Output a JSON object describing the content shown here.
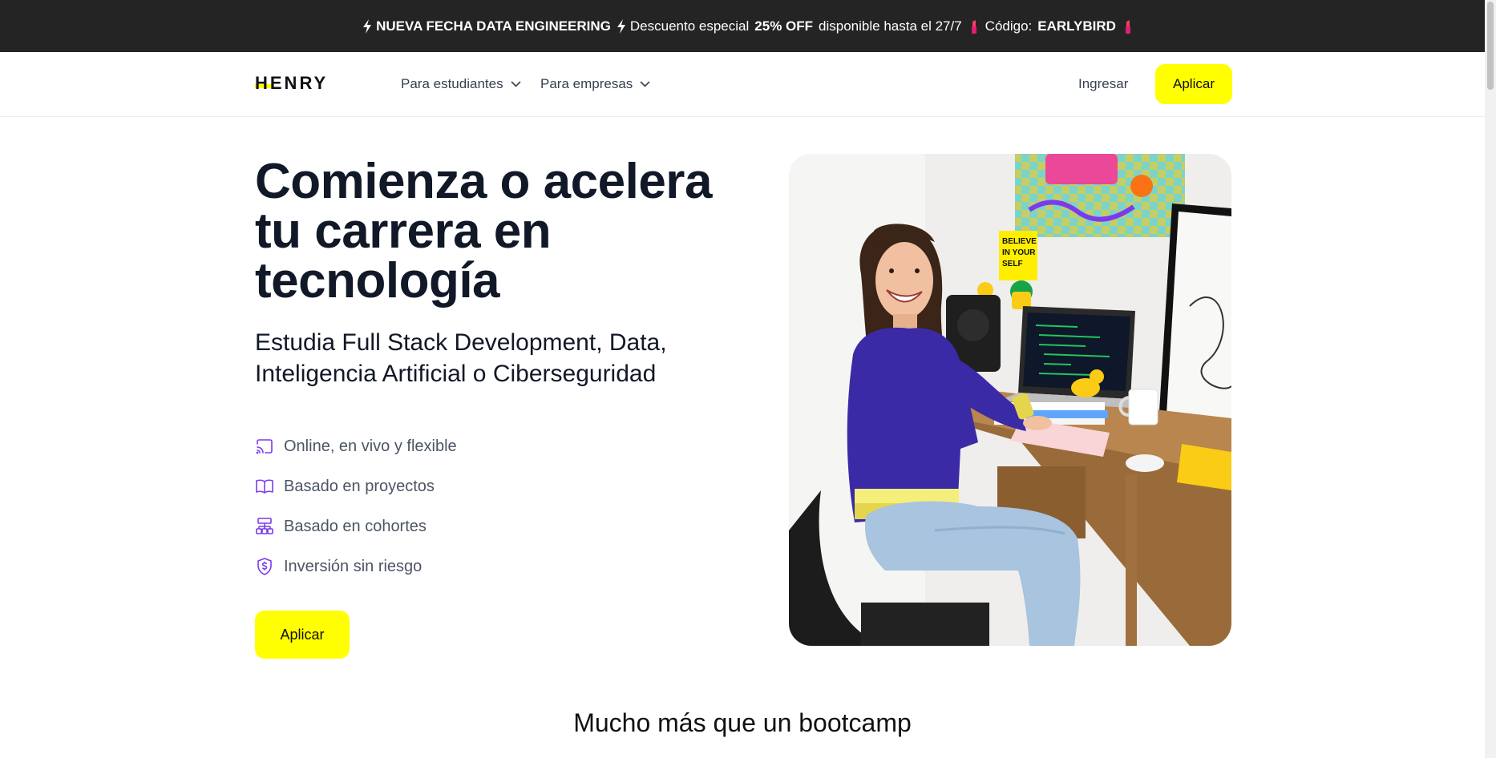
{
  "promo": {
    "title": "NUEVA FECHA DATA ENGINEERING",
    "discount_text": "Descuento especial",
    "discount_value": "25% OFF",
    "availability": "disponible hasta el 27/7",
    "code_label": "Código:",
    "code": "EARLYBIRD",
    "icons": [
      "lightning-icon",
      "lipstick-icon"
    ]
  },
  "nav": {
    "logo_text": "HENRY",
    "links": [
      {
        "label": "Para estudiantes",
        "icon": "chevron-down-icon"
      },
      {
        "label": "Para empresas",
        "icon": "chevron-down-icon"
      }
    ],
    "login_label": "Ingresar",
    "apply_label": "Aplicar"
  },
  "hero": {
    "title_lines": [
      "Comienza o acelera",
      "tu carrera en",
      "tecnología"
    ],
    "subtitle_lines": [
      "Estudia Full Stack Development, Data,",
      "Inteligencia Artificial o Ciberseguridad"
    ],
    "features": [
      {
        "label": "Online, en vivo y flexible",
        "icon": "cast-icon"
      },
      {
        "label": "Basado en proyectos",
        "icon": "book-icon"
      },
      {
        "label": "Basado en cohortes",
        "icon": "network-icon"
      },
      {
        "label": "Inversión sin riesgo",
        "icon": "shield-dollar-icon"
      }
    ],
    "apply_label": "Aplicar",
    "image_poster_text": [
      "BELIEVE",
      "IN YOUR",
      "SELF"
    ]
  },
  "section": {
    "title": "Mucho más que un bootcamp"
  },
  "colors": {
    "promo_bg": "#242424",
    "accent_yellow": "#ffff01",
    "icon_purple": "#7c3aed",
    "text_dark": "#111827"
  }
}
